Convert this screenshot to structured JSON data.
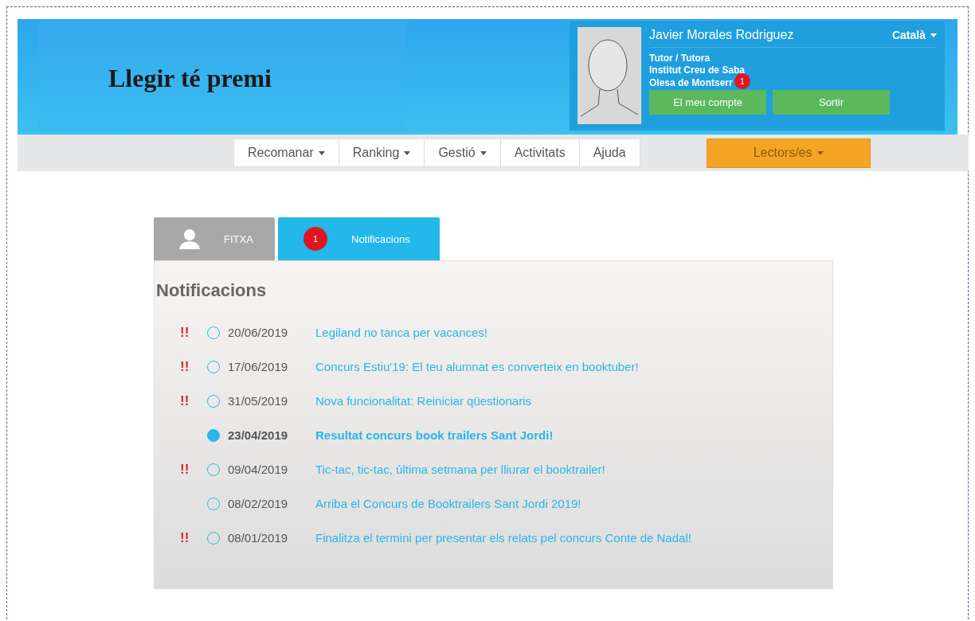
{
  "header": {
    "logo": "Llegir té premi",
    "profile": {
      "name": "Javier Morales Rodriguez",
      "language": "Català",
      "role": "Tutor / Tutora",
      "school": "Institut Creu de Saba",
      "town": "Olesa de Montserr",
      "badge": "1",
      "buttons": [
        "El meu compte",
        "Sortir"
      ]
    }
  },
  "nav": {
    "items": [
      {
        "label": "Recomanar",
        "dropdown": true
      },
      {
        "label": "Ranking",
        "dropdown": true
      },
      {
        "label": "Gestió",
        "dropdown": true
      },
      {
        "label": "Activitats",
        "dropdown": false
      },
      {
        "label": "Ajuda",
        "dropdown": false
      }
    ],
    "readers": {
      "label": "Lectors/es",
      "dropdown": true
    }
  },
  "tabs": [
    {
      "label": "FITXA",
      "selected": false,
      "kind": "profile"
    },
    {
      "label": "Notificacions",
      "selected": true,
      "kind": "badge",
      "badge": "1"
    }
  ],
  "panel": {
    "title": "Notificacions",
    "notifications": [
      {
        "flag": "!!",
        "unread": false,
        "date": "20/06/2019",
        "title": "Legiland no tanca per vacances!"
      },
      {
        "flag": "!!",
        "unread": false,
        "date": "17/06/2019",
        "title": "Concurs Estiu'19: El teu alumnat es converteix en booktuber!"
      },
      {
        "flag": "!!",
        "unread": false,
        "date": "31/05/2019",
        "title": "Nova funcionalitat: Reiniciar qüestionaris"
      },
      {
        "unread": true,
        "date": "23/04/2019",
        "title": "Resultat concurs book trailers Sant Jordi!"
      },
      {
        "flag": "!!",
        "unread": false,
        "date": "09/04/2019",
        "title": "Tic-tac, tic-tac, última setmana per lliurar el booktrailer!"
      },
      {
        "unread": false,
        "date": "08/02/2019",
        "title": "Arriba el Concurs de Booktrailers Sant Jordi 2019!"
      },
      {
        "flag": "!!",
        "unread": false,
        "date": "08/01/2019",
        "title": "Finalitza el termini per presentar els relats pel concurs Conte de Nadal!"
      }
    ]
  }
}
